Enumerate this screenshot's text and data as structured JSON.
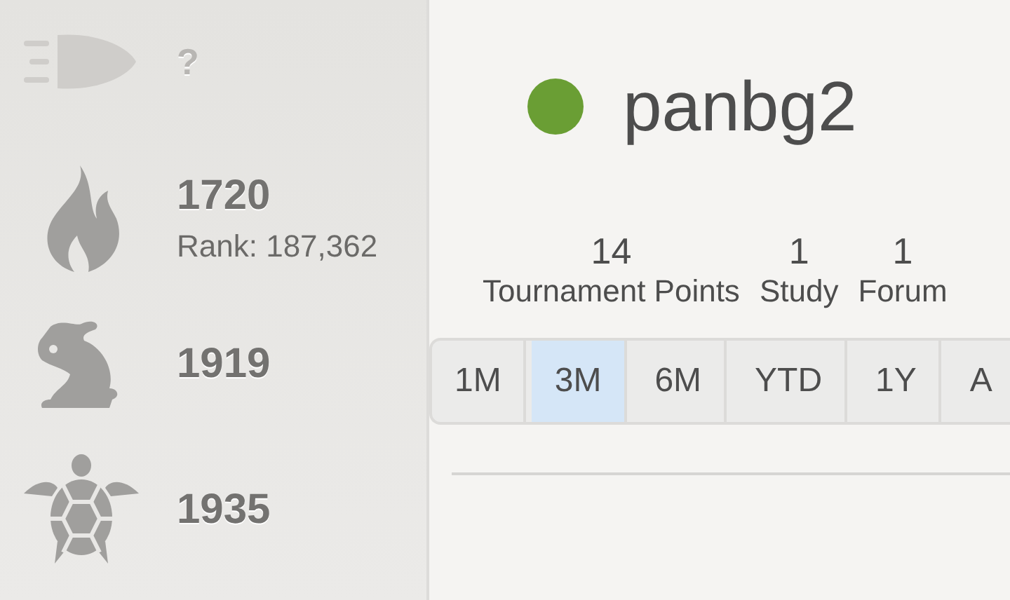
{
  "ratings": [
    {
      "kind": "bullet",
      "rating": "?",
      "provisional": true
    },
    {
      "kind": "blitz",
      "rating": "1720",
      "rank": "Rank: 187,362",
      "provisional": false
    },
    {
      "kind": "rapid",
      "rating": "1919",
      "provisional": false
    },
    {
      "kind": "classical",
      "rating": "1935",
      "provisional": false
    }
  ],
  "user": {
    "name": "panbg2",
    "online": true
  },
  "stats": [
    {
      "value": "14",
      "label": "Tournament Points"
    },
    {
      "value": "1",
      "label": "Study"
    },
    {
      "value": "1",
      "label": "Forum"
    }
  ],
  "ranges": [
    {
      "label": "1M",
      "selected": false
    },
    {
      "label": "3M",
      "selected": true
    },
    {
      "label": "6M",
      "selected": false
    },
    {
      "label": "YTD",
      "selected": false
    },
    {
      "label": "1Y",
      "selected": false
    },
    {
      "label": "A",
      "selected": false
    }
  ]
}
